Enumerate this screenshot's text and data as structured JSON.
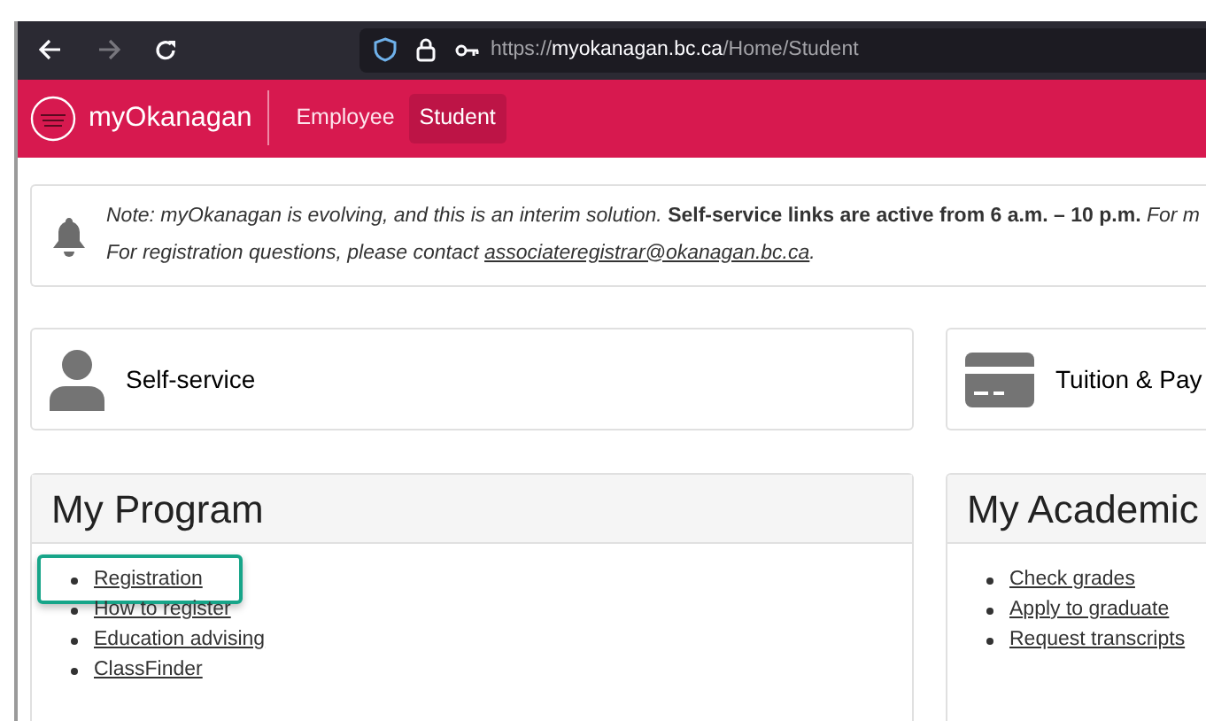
{
  "browser": {
    "url": {
      "scheme": "https://",
      "host": "myokanagan.bc.ca",
      "path": "/Home/Student"
    }
  },
  "navbar": {
    "brand": "myOkanagan",
    "tabs": [
      {
        "label": "Employee",
        "selected": false
      },
      {
        "label": "Student",
        "selected": true
      }
    ]
  },
  "notice": {
    "line_1": "*Note: myOkanagan is evolving, and this is an interim solution.* **Self-service links are active from 6 a.m. – 10 p.m.** *For m*",
    "line_2_prefix": "For registration questions, please contact ",
    "line_2_link": "associateregistrar@okanagan.bc.ca",
    "line_2_suffix": "."
  },
  "cards": [
    {
      "kind": "person",
      "label": "Self-service"
    },
    {
      "kind": "card",
      "label": "Tuition & Pay"
    }
  ],
  "panels": [
    {
      "title": "My Program",
      "links": [
        {
          "label": "Registration",
          "highlighted": true
        },
        {
          "label": "How to register",
          "highlighted": false
        },
        {
          "label": "Education advising",
          "highlighted": false
        },
        {
          "label": "ClassFinder",
          "highlighted": false
        }
      ]
    },
    {
      "title": "My Academic",
      "links": [
        {
          "label": "Check grades",
          "highlighted": false
        },
        {
          "label": "Apply to graduate",
          "highlighted": false
        },
        {
          "label": "Request transcripts",
          "highlighted": false
        }
      ]
    }
  ]
}
